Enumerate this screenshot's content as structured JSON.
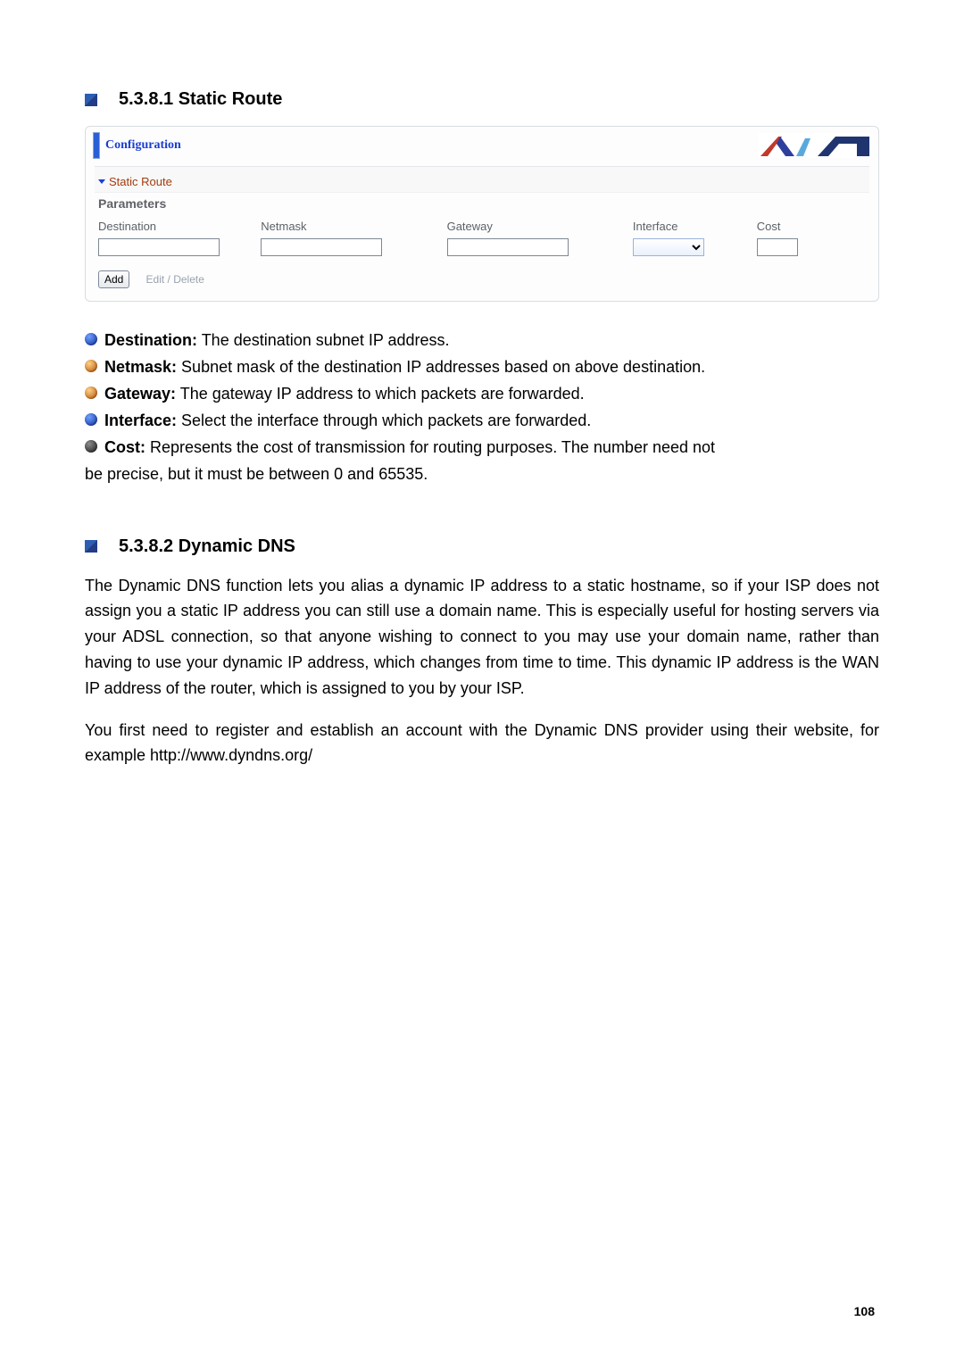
{
  "section1": {
    "number_title": "5.3.8.1 Static Route"
  },
  "panel": {
    "title": "Configuration",
    "sub_title": "Static Route",
    "parameters_label": "Parameters",
    "headers": {
      "destination": "Destination",
      "netmask": "Netmask",
      "gateway": "Gateway",
      "interface": "Interface",
      "cost": "Cost"
    },
    "inputs": {
      "destination": "",
      "netmask": "",
      "gateway": "",
      "interface": "",
      "cost": ""
    },
    "buttons": {
      "add": "Add",
      "edit_delete": "Edit / Delete"
    }
  },
  "desc": {
    "d1_b": "Destination:",
    "d1_t": " The destination subnet IP address.",
    "d2_b": "Netmask:",
    "d2_t": " Subnet mask of the destination IP addresses based on above destination.",
    "d3_b": "Gateway:",
    "d3_t": " The gateway IP address to which packets are forwarded.",
    "d4_b": "Interface:",
    "d4_t": " Select the interface through which packets are forwarded.",
    "d5_b": "Cost:",
    "d5_t": " Represents the cost of transmission for routing purposes. The number need not",
    "d5_cont": "be precise, but it must be between 0 and 65535."
  },
  "section2": {
    "number_title": "5.3.8.2 Dynamic DNS"
  },
  "para1": "The Dynamic DNS function lets you alias a dynamic IP address to a static hostname, so if your ISP does not assign you a static IP address you can still use a domain name. This is especially useful for hosting servers via your ADSL connection, so that anyone wishing to connect to you may use your domain name, rather than having to use your dynamic IP address, which changes from time to time. This dynamic IP address is the WAN IP address of the router, which is assigned to you by your ISP.",
  "para2": "You first need to register and establish an account with the Dynamic DNS provider using their website, for example http://www.dyndns.org/",
  "page_number": "108"
}
